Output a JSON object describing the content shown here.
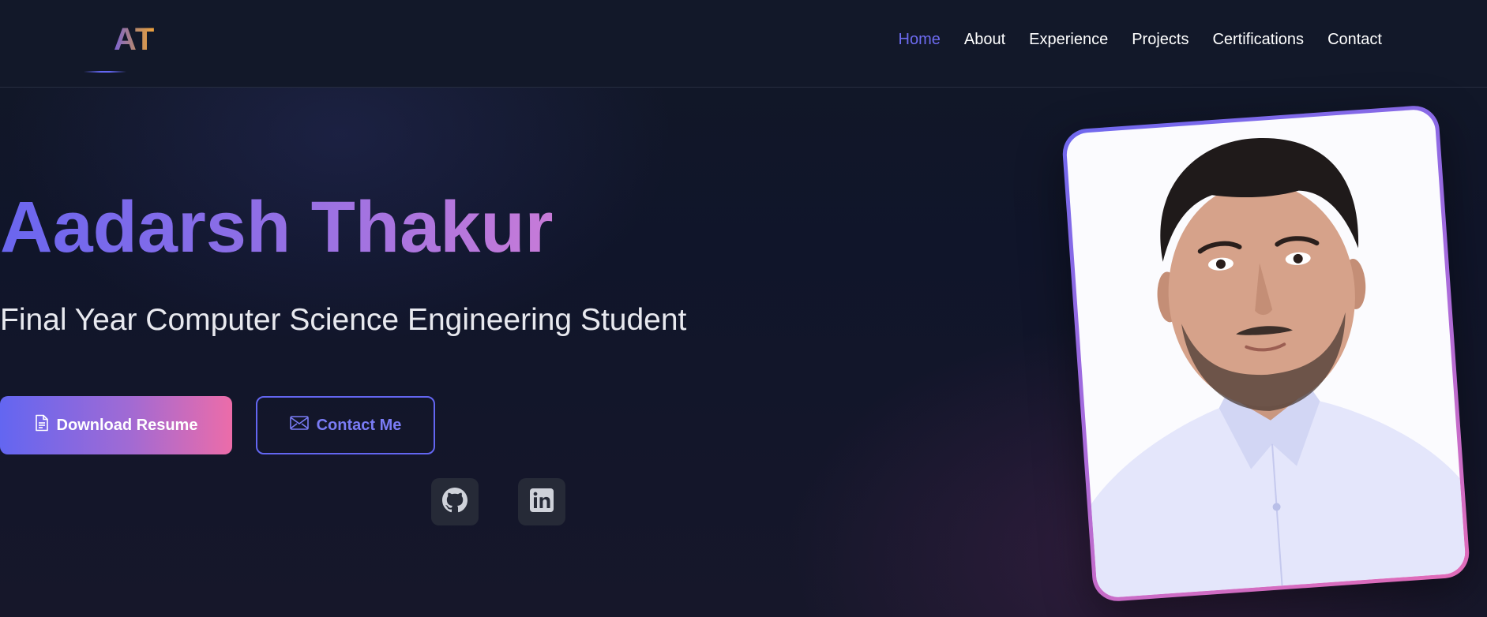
{
  "brand": {
    "logo_text": "AT"
  },
  "nav": {
    "items": [
      {
        "label": "Home",
        "active": true
      },
      {
        "label": "About",
        "active": false
      },
      {
        "label": "Experience",
        "active": false
      },
      {
        "label": "Projects",
        "active": false
      },
      {
        "label": "Certifications",
        "active": false
      },
      {
        "label": "Contact",
        "active": false
      }
    ]
  },
  "hero": {
    "name": "Aadarsh Thakur",
    "subtitle": "Final Year Computer Science Engineering Student",
    "primary_button": {
      "label": "Download Resume",
      "icon": "document-icon"
    },
    "secondary_button": {
      "label": "Contact Me",
      "icon": "mail-icon"
    },
    "socials": [
      {
        "name": "GitHub",
        "icon": "github-icon"
      },
      {
        "name": "LinkedIn",
        "icon": "linkedin-icon"
      }
    ]
  },
  "profile_photo": {
    "icon": "profile-photo"
  },
  "colors": {
    "accent": "#6366f1",
    "accent_pink": "#ec6ca9",
    "background": "#0f1424",
    "nav_background": "#121829"
  }
}
